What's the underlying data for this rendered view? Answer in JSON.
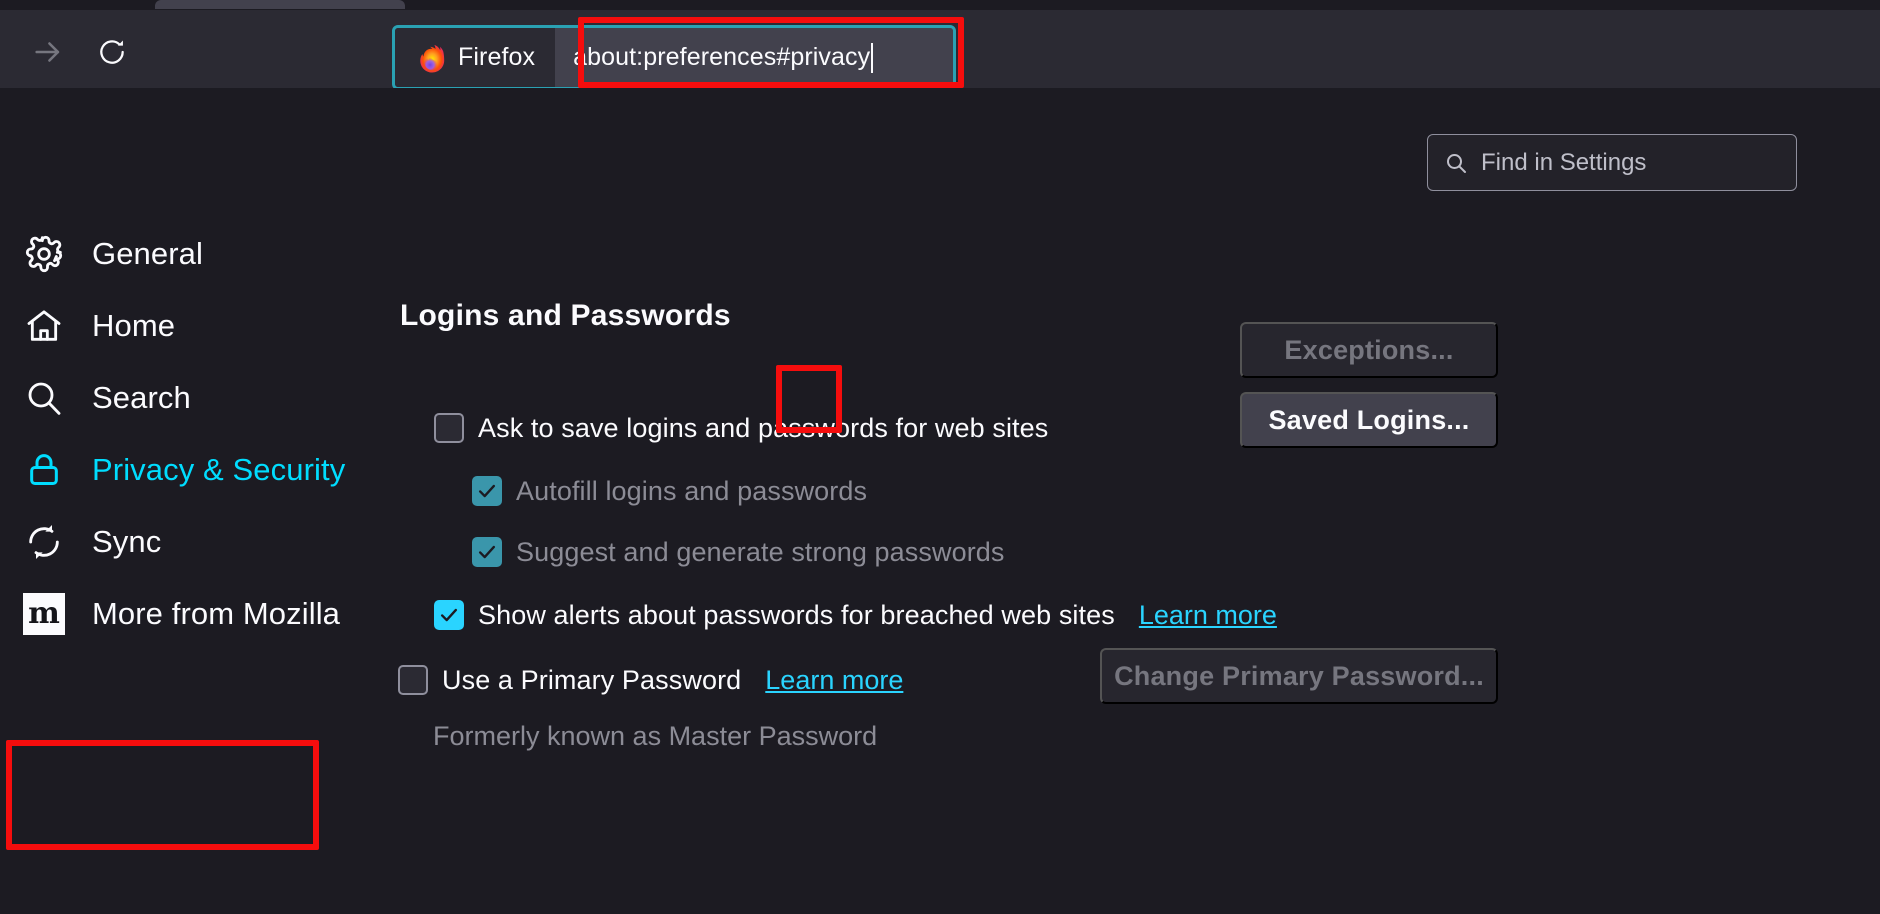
{
  "browser": {
    "tab_strip_visible": true,
    "forward_button_icon": "arrow-right-icon",
    "reload_button_icon": "reload-icon",
    "urlbar": {
      "brand_icon": "firefox-logo-icon",
      "brand_label": "Firefox",
      "value": "about:preferences#privacy",
      "focused": true,
      "focus_ring_color": "#2aa1b3"
    }
  },
  "annotations": {
    "highlight_color": "#f50d0d",
    "boxes": [
      {
        "name": "urlbar-input",
        "label": "about:preferences#privacy"
      },
      {
        "name": "sidebar-item-privacy-security",
        "label": "Privacy & Security"
      },
      {
        "name": "ask-to-save-logins-checkbox",
        "label": "Ask to save logins and passwords for web sites"
      }
    ]
  },
  "search": {
    "icon": "search-icon",
    "placeholder": "Find in Settings",
    "value": ""
  },
  "sidebar": {
    "selected": "Privacy & Security",
    "selected_color": "#00ddff",
    "items": [
      {
        "label": "General",
        "icon": "gear-icon",
        "selected": false
      },
      {
        "label": "Home",
        "icon": "home-icon",
        "selected": false
      },
      {
        "label": "Search",
        "icon": "search-icon",
        "selected": false
      },
      {
        "label": "Privacy & Security",
        "icon": "lock-icon",
        "selected": true
      },
      {
        "label": "Sync",
        "icon": "sync-icon",
        "selected": false
      },
      {
        "label": "More from Mozilla",
        "icon": "mozilla-wordmark-icon",
        "selected": false,
        "icon_text": "m"
      }
    ]
  },
  "main": {
    "section_title": "Logins and Passwords",
    "rows": [
      {
        "id": "ask-save",
        "label": "Ask to save logins and passwords for web sites",
        "checked": false,
        "enabled": true,
        "indent": 0
      },
      {
        "id": "autofill",
        "label": "Autofill logins and passwords",
        "checked": true,
        "enabled": false,
        "indent": 1
      },
      {
        "id": "suggest",
        "label": "Suggest and generate strong passwords",
        "checked": true,
        "enabled": false,
        "indent": 1
      },
      {
        "id": "alerts",
        "label": "Show alerts about passwords for breached web sites",
        "checked": true,
        "enabled": true,
        "indent": 0,
        "link": "Learn more"
      },
      {
        "id": "primary-password",
        "label": "Use a Primary Password",
        "checked": false,
        "enabled": true,
        "indent": 0,
        "link": "Learn more"
      }
    ],
    "note": "Formerly known as Master Password",
    "buttons": [
      {
        "id": "exceptions",
        "label": "Exceptions...",
        "enabled": false
      },
      {
        "id": "saved-logins",
        "label": "Saved Logins...",
        "enabled": true
      },
      {
        "id": "change-primary",
        "label": "Change Primary Password...",
        "enabled": false
      }
    ]
  },
  "colors": {
    "page_background": "#1c1b22",
    "chrome_background": "#2b2a33",
    "urlbar_field": "#42414d",
    "text_primary": "#fbfbfe",
    "text_disabled": "#8c8c96",
    "accent_cyan": "#2ad4ff",
    "accent_selected": "#00ddff",
    "checkbox_disabled_fill": "#3a96ab"
  }
}
